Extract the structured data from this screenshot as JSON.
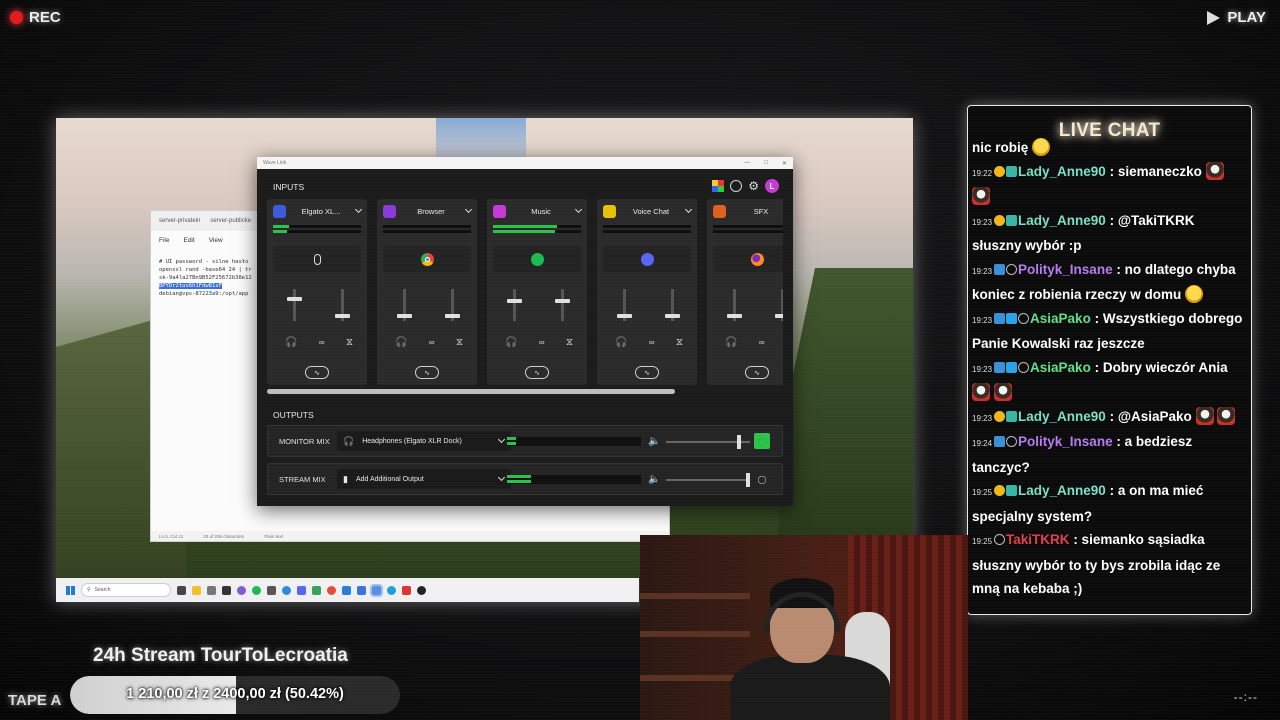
{
  "overlay": {
    "rec_label": "REC",
    "play_label": "PLAY",
    "tape_label": "TAPE A",
    "timecode": "--:--"
  },
  "stream": {
    "title": "24h Stream TourToLecroatia",
    "goal_text": "1 210,00 zł  z  2400,00 zł (50.42%)",
    "goal_fraction": 0.5042
  },
  "editor": {
    "tabs": [
      "server-privatein",
      "server-publicke"
    ],
    "menu": [
      "File",
      "Edit",
      "View"
    ],
    "lines": [
      "# UI password - silne hasło",
      "openssl rand -base64 24 | tr",
      "sk-9a4la27Bn9B52F25672b38e12",
      "BPYDr2tuv6h1Fdw81sF",
      "debian@vps-87223a9:/opt/app"
    ],
    "status": [
      "Ln 5, Col 21",
      "20 of 206 characters",
      "Plain text",
      "100%"
    ]
  },
  "taskbar": {
    "search_placeholder": "Search"
  },
  "wave": {
    "window_title": "Wave Link",
    "inputs_label": "INPUTS",
    "outputs_label": "OUTPUTS",
    "avatar_letter": "L",
    "channels": [
      {
        "name": "Elgato XL...",
        "icon_color": "#3b5bdb",
        "meter": 0.18,
        "source_icon": "microphone-icon",
        "fader_a": 0.7,
        "fader_b": 0.1
      },
      {
        "name": "Browser",
        "icon_color": "#8a3ad9",
        "meter": 0.0,
        "source_icon": "chrome-icon",
        "fader_a": 0.1,
        "fader_b": 0.1
      },
      {
        "name": "Music",
        "icon_color": "#c33bd4",
        "meter": 0.73,
        "source_icon": "spotify-icon",
        "fader_a": 0.65,
        "fader_b": 0.65
      },
      {
        "name": "Voice Chat",
        "icon_color": "#e6c300",
        "meter": 0.0,
        "source_icon": "discord-icon",
        "fader_a": 0.1,
        "fader_b": 0.1
      },
      {
        "name": "SFX",
        "icon_color": "#e0601f",
        "meter": 0.0,
        "source_icon": "firefox-icon",
        "fader_a": 0.1,
        "fader_b": 0.1
      }
    ],
    "outputs": [
      {
        "label": "MONITOR MIX",
        "device": "Headphones (Elgato XLR Dock)",
        "meter": 0.07,
        "volume": 0.87,
        "listen_active": true
      },
      {
        "label": "STREAM MIX",
        "device": "Add Additional Output",
        "meter": 0.18,
        "volume": 0.98,
        "listen_active": false
      }
    ],
    "colors": {
      "meter": "#29c24a",
      "listen": "#2ec24a"
    }
  },
  "chat": {
    "title": "LIVE CHAT",
    "partial_top": "nic robię",
    "messages": [
      {
        "time": "19:22",
        "user": "Lady_Anne90",
        "color": "#7be0c6",
        "badges": [
          "sub",
          "tier"
        ],
        "text": ": siemaneczko",
        "emotes": [
          "dog",
          "dog"
        ]
      },
      {
        "time": "19:23",
        "user": "Lady_Anne90",
        "color": "#7be0c6",
        "badges": [
          "sub",
          "tier"
        ],
        "text": ": @TakiTKRK słuszny wybór :p",
        "emotes": []
      },
      {
        "time": "19:23",
        "user": "Polityk_Insane",
        "color": "#b77cf0",
        "badges": [
          "prime",
          "x"
        ],
        "text": ": no dlatego chyba koniec z robienia rzeczy w domu",
        "emotes": [
          "yellow"
        ]
      },
      {
        "time": "19:23",
        "user": "AsiaPako",
        "color": "#5fe08a",
        "badges": [
          "prime",
          "box",
          "x"
        ],
        "text": ": Wszystkiego dobrego Panie Kowalski raz jeszcze",
        "emotes": []
      },
      {
        "time": "19:23",
        "user": "AsiaPako",
        "color": "#5fe08a",
        "badges": [
          "prime",
          "box",
          "x"
        ],
        "text": ": Dobry wieczór Ania",
        "emotes": [
          "dog",
          "dog"
        ]
      },
      {
        "time": "19:23",
        "user": "Lady_Anne90",
        "color": "#7be0c6",
        "badges": [
          "sub",
          "tier"
        ],
        "text": ": @AsiaPako",
        "emotes": [
          "dog",
          "dog"
        ]
      },
      {
        "time": "19:24",
        "user": "Polityk_Insane",
        "color": "#b77cf0",
        "badges": [
          "prime",
          "x"
        ],
        "text": ": a bedziesz tanczyc?",
        "emotes": []
      },
      {
        "time": "19:25",
        "user": "Lady_Anne90",
        "color": "#7be0c6",
        "badges": [
          "sub",
          "tier"
        ],
        "text": ": a on ma mieć specjalny system?",
        "emotes": []
      },
      {
        "time": "19:25",
        "user": "TakiTKRK",
        "color": "#e0404a",
        "badges": [
          "x"
        ],
        "text": ": siemanko sąsiadka słuszny wybór to ty bys zrobila idąc ze mną na kebaba ;)",
        "emotes": []
      }
    ]
  }
}
